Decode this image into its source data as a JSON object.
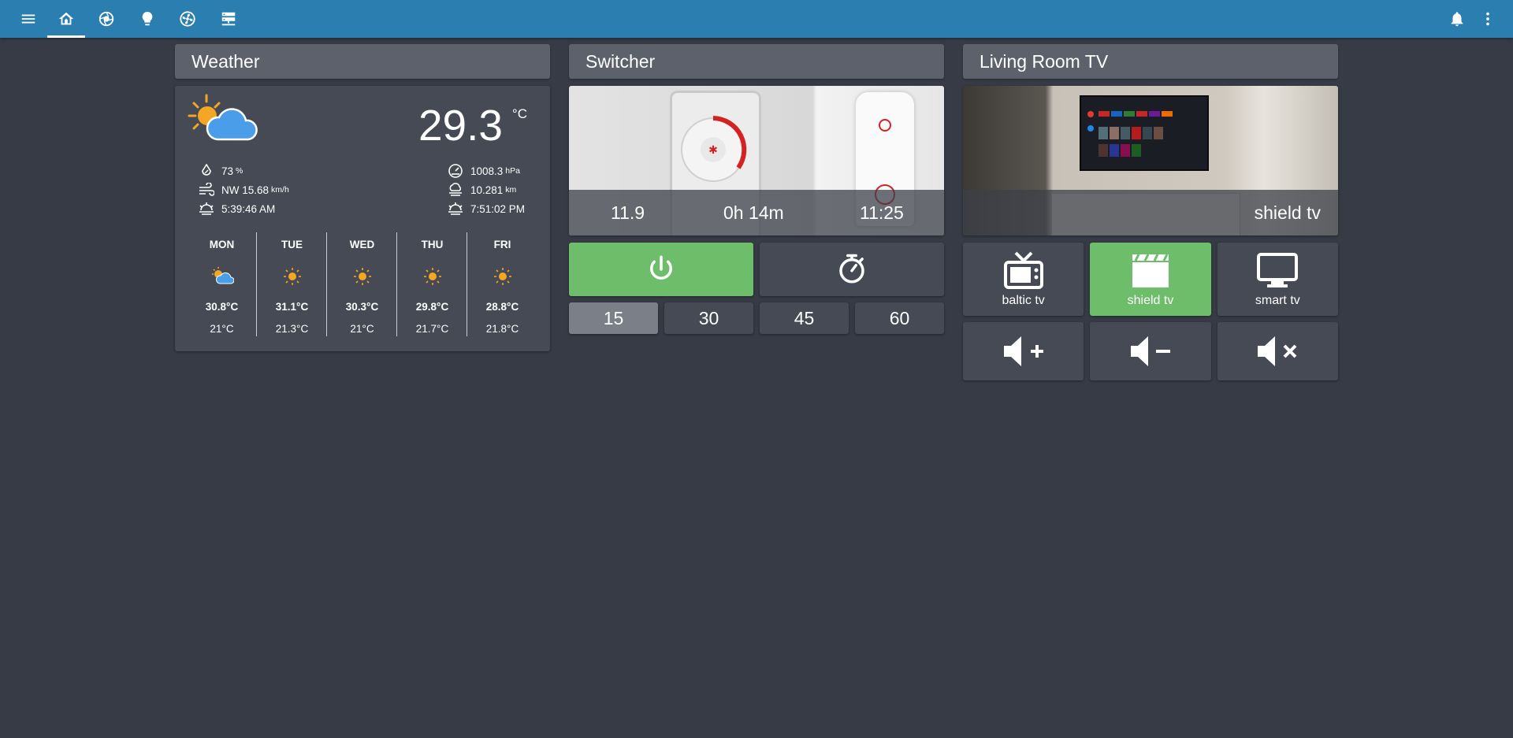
{
  "topbar": {
    "icons": [
      "menu-icon",
      "home-icon",
      "camera-lens-icon",
      "lightbulb-icon",
      "fan-icon",
      "server-icon",
      "bell-icon",
      "more-vertical-icon"
    ],
    "accent": "#2a7fb0"
  },
  "weather": {
    "title": "Weather",
    "condition_icon": "partly-cloudy-icon",
    "temperature": "29.3",
    "unit": "°C",
    "humidity": "73",
    "humidity_unit": "%",
    "wind": "NW 15.68",
    "wind_unit": "km/h",
    "sunrise": "5:39:46 AM",
    "pressure": "1008.3",
    "pressure_unit": "hPa",
    "visibility": "10.281",
    "visibility_unit": "km",
    "sunset": "7:51:02 PM",
    "forecast": [
      {
        "day": "MON",
        "icon": "partly-cloudy-icon",
        "high": "30.8°C",
        "low": "21°C"
      },
      {
        "day": "TUE",
        "icon": "sunny-icon",
        "high": "31.1°C",
        "low": "21.3°C"
      },
      {
        "day": "WED",
        "icon": "sunny-icon",
        "high": "30.3°C",
        "low": "21°C"
      },
      {
        "day": "THU",
        "icon": "sunny-icon",
        "high": "29.8°C",
        "low": "21.7°C"
      },
      {
        "day": "FRI",
        "icon": "sunny-icon",
        "high": "28.8°C",
        "low": "21.8°C"
      }
    ]
  },
  "switcher": {
    "title": "Switcher",
    "power_value": "11.9",
    "remaining": "0h 14m",
    "end_time": "11:25",
    "power_button_icon": "power-icon",
    "timer_button_icon": "timer-icon",
    "power_on_color": "#6dbd6b",
    "timers": [
      "15",
      "30",
      "45",
      "60"
    ],
    "selected_timer": "15"
  },
  "tv": {
    "title": "Living Room TV",
    "current_source": "shield tv",
    "sources": [
      {
        "label": "baltic tv",
        "icon": "television-classic-icon",
        "active": false
      },
      {
        "label": "shield tv",
        "icon": "movie-clapper-icon",
        "active": true
      },
      {
        "label": "smart tv",
        "icon": "monitor-icon",
        "active": false
      }
    ],
    "volume": [
      "volume-plus-icon",
      "volume-minus-icon",
      "volume-mute-icon"
    ]
  }
}
